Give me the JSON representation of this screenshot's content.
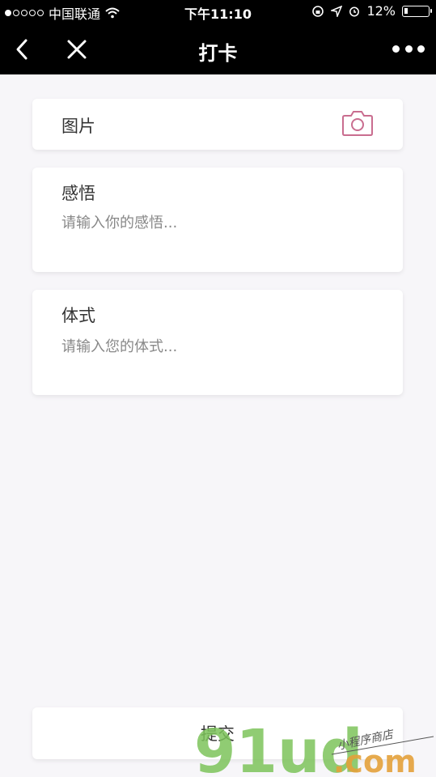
{
  "status": {
    "carrier": "中国联通",
    "time": "下午11:10",
    "battery": "12%"
  },
  "nav": {
    "title": "打卡"
  },
  "form": {
    "image_label": "图片",
    "insight_label": "感悟",
    "insight_placeholder": "请输入你的感悟...",
    "pose_label": "体式",
    "pose_placeholder": "请输入您的体式...",
    "submit_label": "提交"
  },
  "watermark": {
    "brand": "91ud",
    "domain": ".com",
    "tagline": "小程序商店"
  },
  "icons": {
    "back": "chevron-left-icon",
    "close": "close-icon",
    "more": "more-dots-icon",
    "camera": "camera-icon",
    "wifi": "wifi-icon",
    "battery": "battery-icon"
  },
  "colors": {
    "accent": "#c96d8f",
    "background": "#f7f6f9"
  }
}
